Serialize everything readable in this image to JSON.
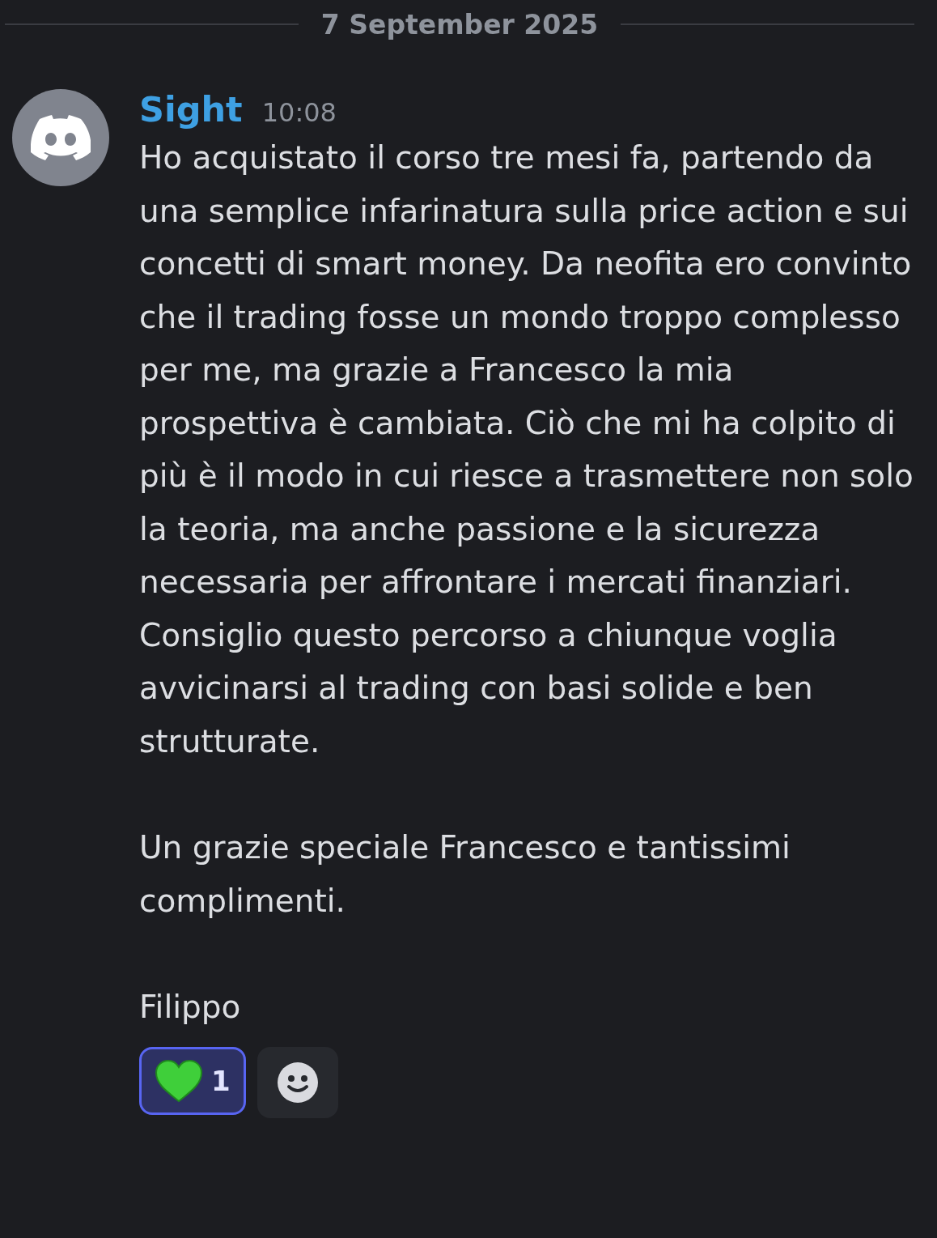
{
  "date_divider": "7 September 2025",
  "message": {
    "author": "Sight",
    "time": "10:08",
    "paragraphs": [
      "Ho acquistato il corso tre mesi fa, partendo da una semplice infarinatura sulla price action e sui concetti di smart money. Da neofita ero convinto che il trading fosse un mondo troppo complesso per me, ma grazie a Francesco la mia prospettiva è cambiata. Ciò che mi ha colpito di più è il modo in cui riesce a trasmettere non solo la teoria, ma anche passione e la sicurezza necessaria per affrontare i mercati finanziari. Consiglio questo percorso a chiunque voglia avvicinarsi al trading con basi solide e ben strutturate.",
      "Un grazie speciale Francesco e tantissimi complimenti.",
      "Filippo"
    ],
    "reactions": [
      {
        "kind": "heart",
        "count": "1",
        "selected": true
      }
    ]
  }
}
